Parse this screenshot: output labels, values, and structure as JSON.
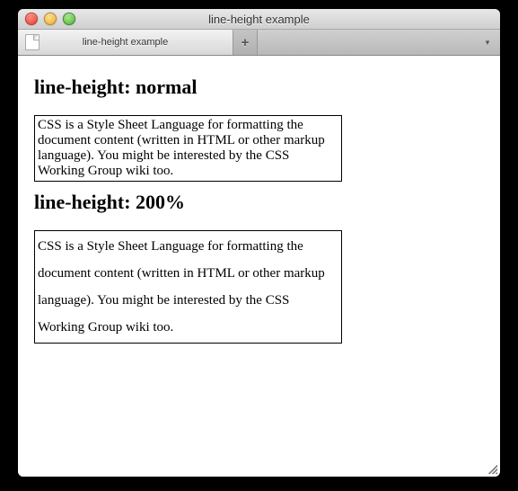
{
  "window": {
    "title": "line-height example"
  },
  "tabs": {
    "active_label": "line-height example",
    "new_tab_glyph": "+",
    "overflow_glyph": "▾"
  },
  "content": {
    "heading1": "line-height: normal",
    "box1_text": "CSS is a Style Sheet Language for formatting the document content (written in HTML or other markup language). You might be interested by the CSS Working Group wiki too.",
    "heading2": "line-height: 200%",
    "box2_text": "CSS is a Style Sheet Language for formatting the document content (written in HTML or other markup language). You might be interested by the CSS Working Group wiki too."
  }
}
